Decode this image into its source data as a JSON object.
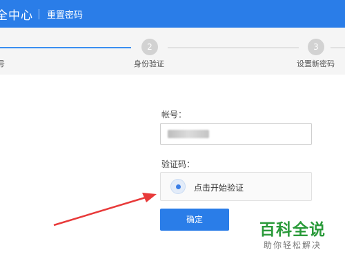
{
  "header": {
    "title": "全中心",
    "subtitle": "重置密码",
    "bg_color": "#2a7de8"
  },
  "steps": {
    "items": [
      {
        "number": "",
        "label": "号",
        "state": "done"
      },
      {
        "number": "2",
        "label": "身份验证",
        "state": "pending"
      },
      {
        "number": "3",
        "label": "设置新密码",
        "state": "pending"
      }
    ],
    "active_color": "#3a8ef0"
  },
  "form": {
    "account_label": "帐号：",
    "account_value": "",
    "verify_label": "验证码：",
    "verify_prompt": "点击开始验证",
    "confirm_label": "确定"
  },
  "watermark": {
    "title": "百科全说",
    "subtitle": "助你轻松解决"
  },
  "annotation": {
    "arrow_color": "#e83a3a"
  }
}
